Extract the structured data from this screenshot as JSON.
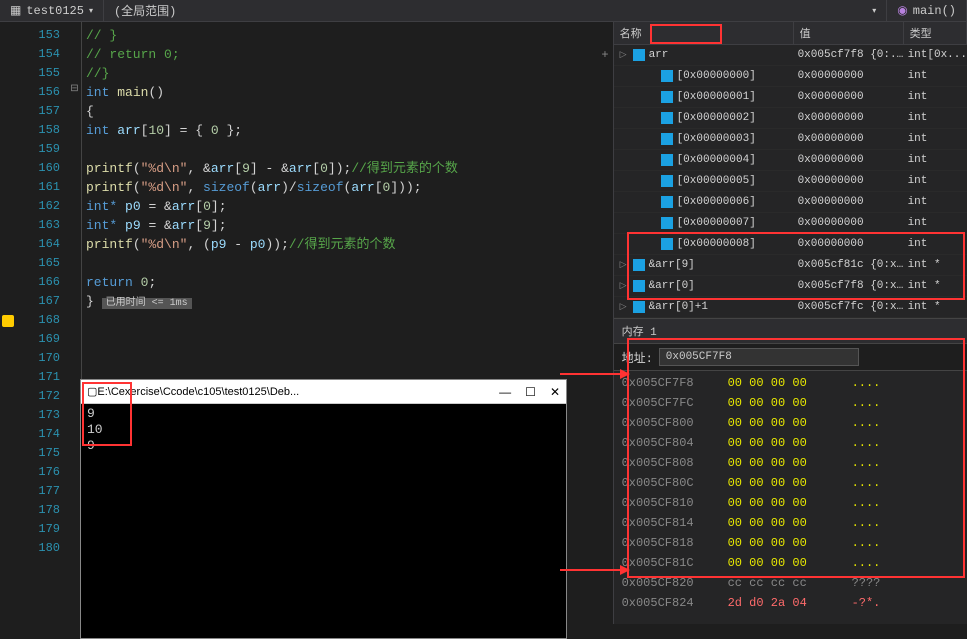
{
  "tabs": {
    "file": "test0125",
    "scope": "(全局范围)",
    "func": "main()"
  },
  "gutter_start": 153,
  "code_lines": [
    {
      "i": 0,
      "html": "<span class='cmt'>//  }</span>"
    },
    {
      "i": 1,
      "html": "<span class='cmt'>//  return 0;</span>"
    },
    {
      "i": 2,
      "html": "<span class='cmt'>//}</span>"
    },
    {
      "i": 3,
      "html": "<span class='kw'>int</span> <span class='fn'>main</span>()",
      "fold": "⊟"
    },
    {
      "i": 4,
      "html": "{"
    },
    {
      "i": 5,
      "html": "    <span class='kw'>int</span> <span class='var'>arr</span>[<span class='num'>10</span>] = { <span class='num'>0</span> };"
    },
    {
      "i": 6,
      "html": "&nbsp;"
    },
    {
      "i": 7,
      "html": "    <span class='fn'>printf</span>(<span class='str'>\"%d\\n\"</span>, &amp;<span class='var'>arr</span>[<span class='num'>9</span>] - &amp;<span class='var'>arr</span>[<span class='num'>0</span>]);<span class='cmt'>//得到元素的个数</span>"
    },
    {
      "i": 8,
      "html": "    <span class='fn'>printf</span>(<span class='str'>\"%d\\n\"</span>, <span class='kw'>sizeof</span>(<span class='var'>arr</span>)/<span class='kw'>sizeof</span>(<span class='var'>arr</span>[<span class='num'>0</span>]));"
    },
    {
      "i": 9,
      "html": "    <span class='kw'>int*</span> <span class='var'>p0</span> = &amp;<span class='var'>arr</span>[<span class='num'>0</span>];"
    },
    {
      "i": 10,
      "html": "    <span class='kw'>int*</span> <span class='var'>p9</span> = &amp;<span class='var'>arr</span>[<span class='num'>9</span>];"
    },
    {
      "i": 11,
      "html": "    <span class='fn'>printf</span>(<span class='str'>\"%d\\n\"</span>, (<span class='var'>p9</span> - <span class='var'>p0</span>));<span class='cmt'>//得到元素的个数</span>"
    },
    {
      "i": 12,
      "html": "&nbsp;"
    },
    {
      "i": 13,
      "html": "    <span class='kw'>return</span> <span class='num'>0</span>;"
    },
    {
      "i": 14,
      "html": "}   <span class='elapsed'>已用时间 &lt;= 1ms</span>"
    }
  ],
  "num_blank_after": 13,
  "console": {
    "title": "E:\\Cexercise\\Ccode\\c105\\test0125\\Deb...",
    "lines": [
      "9",
      "10",
      "9"
    ]
  },
  "watch_headers": {
    "name": "名称",
    "value": "值",
    "type": "类型"
  },
  "watch": [
    {
      "name": "arr",
      "val": "0x005cf7f8 {0:...",
      "type": "int[0x...",
      "ind": 0,
      "tri": "▷",
      "hl": true
    },
    {
      "name": "[0x00000000]",
      "val": "0x00000000",
      "type": "int",
      "ind": 1
    },
    {
      "name": "[0x00000001]",
      "val": "0x00000000",
      "type": "int",
      "ind": 1
    },
    {
      "name": "[0x00000002]",
      "val": "0x00000000",
      "type": "int",
      "ind": 1
    },
    {
      "name": "[0x00000003]",
      "val": "0x00000000",
      "type": "int",
      "ind": 1
    },
    {
      "name": "[0x00000004]",
      "val": "0x00000000",
      "type": "int",
      "ind": 1
    },
    {
      "name": "[0x00000005]",
      "val": "0x00000000",
      "type": "int",
      "ind": 1
    },
    {
      "name": "[0x00000006]",
      "val": "0x00000000",
      "type": "int",
      "ind": 1
    },
    {
      "name": "[0x00000007]",
      "val": "0x00000000",
      "type": "int",
      "ind": 1
    },
    {
      "name": "[0x00000008]",
      "val": "0x00000000",
      "type": "int",
      "ind": 1
    },
    {
      "name": "&arr[9]",
      "val": "0x005cf81c {0:x...",
      "type": "int *",
      "ind": 0,
      "tri": "▷"
    },
    {
      "name": "&arr[0]",
      "val": "0x005cf7f8 {0:x...",
      "type": "int *",
      "ind": 0,
      "tri": "▷"
    },
    {
      "name": "&arr[0]+1",
      "val": "0x005cf7fc {0:x...",
      "type": "int *",
      "ind": 0,
      "tri": "▷"
    }
  ],
  "memory": {
    "title": "内存 1",
    "addr_label": "地址:",
    "addr_value": "0x005CF7F8",
    "rows": [
      {
        "a": "0x005CF7F8",
        "h": "00 00 00 00",
        "s": "...."
      },
      {
        "a": "0x005CF7FC",
        "h": "00 00 00 00",
        "s": "...."
      },
      {
        "a": "0x005CF800",
        "h": "00 00 00 00",
        "s": "...."
      },
      {
        "a": "0x005CF804",
        "h": "00 00 00 00",
        "s": "...."
      },
      {
        "a": "0x005CF808",
        "h": "00 00 00 00",
        "s": "...."
      },
      {
        "a": "0x005CF80C",
        "h": "00 00 00 00",
        "s": "...."
      },
      {
        "a": "0x005CF810",
        "h": "00 00 00 00",
        "s": "...."
      },
      {
        "a": "0x005CF814",
        "h": "00 00 00 00",
        "s": "...."
      },
      {
        "a": "0x005CF818",
        "h": "00 00 00 00",
        "s": "...."
      },
      {
        "a": "0x005CF81C",
        "h": "00 00 00 00",
        "s": "...."
      },
      {
        "a": "0x005CF820",
        "h": "cc cc cc cc",
        "s": "????",
        "cls": "gray"
      },
      {
        "a": "0x005CF824",
        "h": "2d d0 2a 04",
        "s": "-?*.",
        "cls": "red"
      }
    ]
  },
  "breakpoint_line": 167
}
